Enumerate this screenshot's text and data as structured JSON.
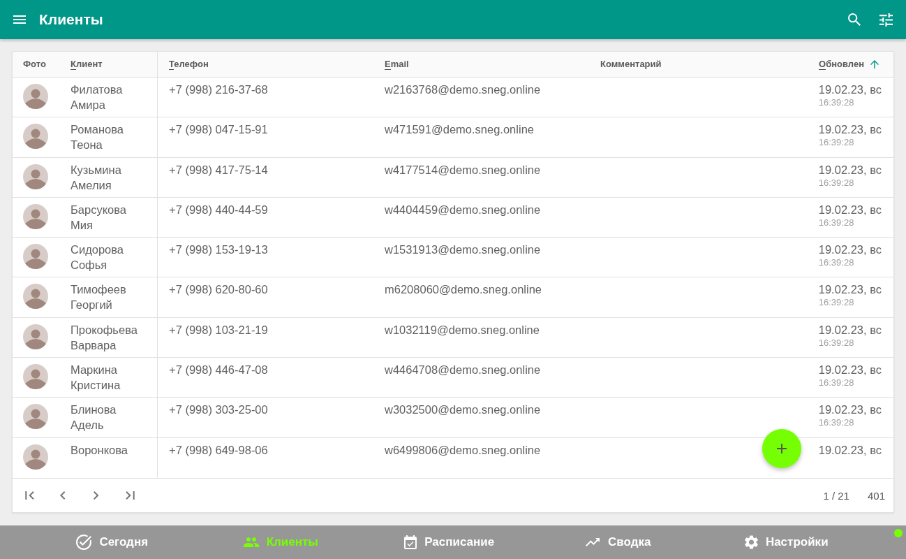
{
  "app_bar": {
    "title": "Клиенты"
  },
  "table": {
    "columns": [
      {
        "label": "Фото",
        "sortable": false,
        "sorted": false
      },
      {
        "label": "Клиент",
        "sortable": true,
        "sorted": false
      },
      {
        "label": "Телефон",
        "sortable": true,
        "sorted": false
      },
      {
        "label": "Email",
        "sortable": true,
        "sorted": false
      },
      {
        "label": "Комментарий",
        "sortable": false,
        "sorted": false
      },
      {
        "label": "Обновлен",
        "sortable": true,
        "sorted": true
      }
    ],
    "rows": [
      {
        "name": "Филатова Амира",
        "phone": "+7 (998) 216-37-68",
        "email": "w2163768@demo.sneg.online",
        "date": "19.02.23, вс",
        "time": "16:39:28"
      },
      {
        "name": "Романова Теона",
        "phone": "+7 (998) 047-15-91",
        "email": "w471591@demo.sneg.online",
        "date": "19.02.23, вс",
        "time": "16:39:28"
      },
      {
        "name": "Кузьмина Амелия",
        "phone": "+7 (998) 417-75-14",
        "email": "w4177514@demo.sneg.online",
        "date": "19.02.23, вс",
        "time": "16:39:28"
      },
      {
        "name": "Барсукова Мия",
        "phone": "+7 (998) 440-44-59",
        "email": "w4404459@demo.sneg.online",
        "date": "19.02.23, вс",
        "time": "16:39:28"
      },
      {
        "name": "Сидорова Софья",
        "phone": "+7 (998) 153-19-13",
        "email": "w1531913@demo.sneg.online",
        "date": "19.02.23, вс",
        "time": "16:39:28"
      },
      {
        "name": "Тимофеев Георгий",
        "phone": "+7 (998) 620-80-60",
        "email": "m6208060@demo.sneg.online",
        "date": "19.02.23, вс",
        "time": "16:39:28"
      },
      {
        "name": "Прокофьева Варвара",
        "phone": "+7 (998) 103-21-19",
        "email": "w1032119@demo.sneg.online",
        "date": "19.02.23, вс",
        "time": "16:39:28"
      },
      {
        "name": "Маркина Кристина",
        "phone": "+7 (998) 446-47-08",
        "email": "w4464708@demo.sneg.online",
        "date": "19.02.23, вс",
        "time": "16:39:28"
      },
      {
        "name": "Блинова Адель",
        "phone": "+7 (998) 303-25-00",
        "email": "w3032500@demo.sneg.online",
        "date": "19.02.23, вс",
        "time": "16:39:28"
      },
      {
        "name": "Воронкова",
        "phone": "+7 (998) 649-98-06",
        "email": "w6499806@demo.sneg.online",
        "date": "19.02.23, вс"
      }
    ]
  },
  "pagination": {
    "page": "1 / 21",
    "total": "401"
  },
  "bottom_nav": [
    {
      "label": "Сегодня",
      "selected": false
    },
    {
      "label": "Клиенты",
      "selected": true
    },
    {
      "label": "Расписание",
      "selected": false
    },
    {
      "label": "Сводка",
      "selected": false
    },
    {
      "label": "Настройки",
      "selected": false
    }
  ],
  "connection": {
    "online": true
  }
}
